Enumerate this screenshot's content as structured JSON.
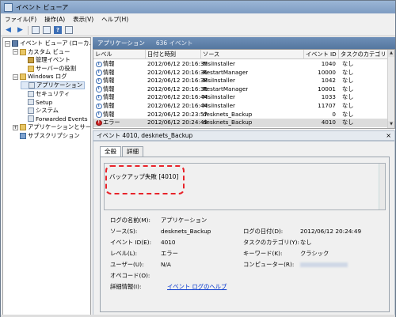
{
  "window": {
    "title": "イベント ビューア"
  },
  "menu": [
    "ファイル(F)",
    "操作(A)",
    "表示(V)",
    "ヘルプ(H)"
  ],
  "tree": {
    "items": [
      {
        "label": "イベント ビューア (ローカル)",
        "level": 0,
        "expander": "−",
        "icon": "event-viewer-icon"
      },
      {
        "label": "カスタム ビュー",
        "level": 1,
        "expander": "−",
        "icon": "folder-icon"
      },
      {
        "label": "管理イベント",
        "level": 2,
        "expander": "",
        "icon": "filter-icon"
      },
      {
        "label": "サーバーの役割",
        "level": 2,
        "expander": "",
        "icon": "folder-icon"
      },
      {
        "label": "Windows ログ",
        "level": 1,
        "expander": "−",
        "icon": "folder-icon"
      },
      {
        "label": "アプリケーション",
        "level": 2,
        "expander": "",
        "icon": "log-icon",
        "selected": true
      },
      {
        "label": "セキュリティ",
        "level": 2,
        "expander": "",
        "icon": "log-icon"
      },
      {
        "label": "Setup",
        "level": 2,
        "expander": "",
        "icon": "log-icon"
      },
      {
        "label": "システム",
        "level": 2,
        "expander": "",
        "icon": "log-icon"
      },
      {
        "label": "Forwarded Events",
        "level": 2,
        "expander": "",
        "icon": "log-icon"
      },
      {
        "label": "アプリケーションとサービス ロ",
        "level": 1,
        "expander": "+",
        "icon": "folder-icon"
      },
      {
        "label": "サブスクリプション",
        "level": 1,
        "expander": "",
        "icon": "subscription-icon"
      }
    ]
  },
  "list": {
    "header_title": "アプリケーション",
    "header_count": "636 イベント",
    "columns": [
      "レベル",
      "日付と時刻",
      "ソース",
      "イベント ID",
      "タスクのカテゴリ"
    ],
    "rows": [
      {
        "level": "情報",
        "type": "info",
        "datetime": "2012/06/12 20:16:35",
        "source": "MsiInstaller",
        "id": "1040",
        "category": "なし"
      },
      {
        "level": "情報",
        "type": "info",
        "datetime": "2012/06/12 20:16:36",
        "source": "RestartManager",
        "id": "10000",
        "category": "なし"
      },
      {
        "level": "情報",
        "type": "info",
        "datetime": "2012/06/12 20:16:38",
        "source": "MsiInstaller",
        "id": "1042",
        "category": "なし"
      },
      {
        "level": "情報",
        "type": "info",
        "datetime": "2012/06/12 20:16:38",
        "source": "RestartManager",
        "id": "10001",
        "category": "なし"
      },
      {
        "level": "情報",
        "type": "info",
        "datetime": "2012/06/12 20:16:44",
        "source": "MsiInstaller",
        "id": "1033",
        "category": "なし"
      },
      {
        "level": "情報",
        "type": "info",
        "datetime": "2012/06/12 20:16:44",
        "source": "MsiInstaller",
        "id": "11707",
        "category": "なし"
      },
      {
        "level": "情報",
        "type": "info",
        "datetime": "2012/06/12 20:23:57",
        "source": "desknets_Backup",
        "id": "0",
        "category": "なし"
      },
      {
        "level": "エラー",
        "type": "error",
        "datetime": "2012/06/12 20:24:49",
        "source": "desknets_Backup",
        "id": "4010",
        "category": "なし",
        "selected": true
      }
    ]
  },
  "detail": {
    "title": "イベント 4010, desknets_Backup",
    "tabs": [
      "全般",
      "詳細"
    ],
    "message": "バックアップ失敗 [4010]",
    "fields": {
      "log_name_label": "ログの名前(M):",
      "log_name_value": "アプリケーション",
      "source_label": "ソース(S):",
      "source_value": "desknets_Backup",
      "logged_label": "ログの日付(D):",
      "logged_value": "2012/06/12 20:24:49",
      "event_id_label": "イベント ID(E):",
      "event_id_value": "4010",
      "task_category_label": "タスクのカテゴリ(Y):",
      "task_category_value": "なし",
      "level_label": "レベル(L):",
      "level_value": "エラー",
      "keywords_label": "キーワード(K):",
      "keywords_value": "クラシック",
      "user_label": "ユーザー(U):",
      "user_value": "N/A",
      "computer_label": "コンピューター(R):",
      "opcode_label": "オペコード(O):",
      "more_info_label": "詳細情報(I):",
      "more_info_link": "イベント ログのヘルプ"
    }
  }
}
